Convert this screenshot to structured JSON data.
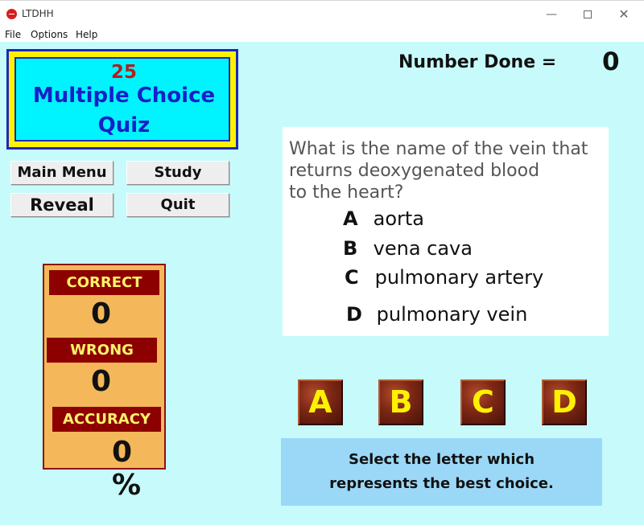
{
  "window": {
    "title": "LTDHH",
    "controls": [
      "—",
      "□",
      "✕"
    ]
  },
  "menu": [
    "File",
    "Options",
    "Help"
  ],
  "quiz": {
    "count": "25",
    "title_line1": "Multiple Choice",
    "title_line2": "Quiz"
  },
  "buttons": {
    "main_menu": "Main Menu",
    "study": "Study",
    "reveal": "Reveal",
    "quit": "Quit"
  },
  "score": {
    "correct_label": "CORRECT",
    "correct_value": "0",
    "wrong_label": "WRONG",
    "wrong_value": "0",
    "accuracy_label": "ACCURACY",
    "accuracy_value": "0 %"
  },
  "progress": {
    "label": "Number Done =",
    "value": "0"
  },
  "question": {
    "text": "What is the name of the vein that\nreturns deoxygenated blood\nto the heart?",
    "choices": [
      {
        "letter": "A",
        "text": "aorta"
      },
      {
        "letter": "B",
        "text": "vena cava"
      },
      {
        "letter": "C",
        "text": "pulmonary artery"
      },
      {
        "letter": "D",
        "text": "pulmonary vein"
      }
    ]
  },
  "answer_buttons": [
    "A",
    "B",
    "C",
    "D"
  ],
  "instruction": {
    "line1": "Select the letter which",
    "line2": "represents the best choice."
  },
  "colors": {
    "background": "#c7fbfb",
    "banner_yellow": "#fff200",
    "banner_cyan": "#00f4ff",
    "score_panel": "#f4b85a",
    "answer_button": "#7f2815",
    "instruction_panel": "#9bd8f8"
  },
  "icons": {
    "app": "app-logo-icon"
  }
}
